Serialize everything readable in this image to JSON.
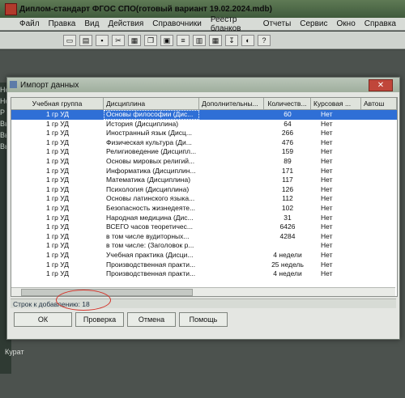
{
  "app": {
    "title": "Диплом-стандарт ФГОС СПО(готовый вариант 19.02.2024.mdb)",
    "menu": [
      "Файл",
      "Правка",
      "Вид",
      "Действия",
      "Справочники",
      "Реестр бланков",
      "Отчеты",
      "Сервис",
      "Окно",
      "Справка"
    ],
    "left_strip": [
      "Нс",
      "Нс",
      "Р",
      "Вы",
      "Вы",
      "Вы"
    ],
    "bottom_text": "Курат"
  },
  "dialog": {
    "title": "Импорт данных",
    "close_label": "✕",
    "columns": [
      "Учебная группа",
      "Дисциплина",
      "Дополнительны...",
      "Количеств...",
      "Курсовая ...",
      "Автош"
    ],
    "rows": [
      {
        "group": "1 гр УД",
        "discipline": "Основы философии (Дис...",
        "extra": "",
        "count": "60",
        "course": "Нет"
      },
      {
        "group": "1 гр УД",
        "discipline": "История (Дисциплина)",
        "extra": "",
        "count": "64",
        "course": "Нет"
      },
      {
        "group": "1 гр УД",
        "discipline": "Иностранный язык (Дисц...",
        "extra": "",
        "count": "266",
        "course": "Нет"
      },
      {
        "group": "1 гр УД",
        "discipline": "Физическая культура (Ди...",
        "extra": "",
        "count": "476",
        "course": "Нет"
      },
      {
        "group": "1 гр УД",
        "discipline": "Религиоведение (Дисципл...",
        "extra": "",
        "count": "159",
        "course": "Нет"
      },
      {
        "group": "1 гр УД",
        "discipline": "Основы мировых религий...",
        "extra": "",
        "count": "89",
        "course": "Нет"
      },
      {
        "group": "1 гр УД",
        "discipline": "Информатика (Дисциплин...",
        "extra": "",
        "count": "171",
        "course": "Нет"
      },
      {
        "group": "1 гр УД",
        "discipline": "Математика (Дисциплина)",
        "extra": "",
        "count": "117",
        "course": "Нет"
      },
      {
        "group": "1 гр УД",
        "discipline": "Психология (Дисциплина)",
        "extra": "",
        "count": "126",
        "course": "Нет"
      },
      {
        "group": "1 гр УД",
        "discipline": "Основы латинского языка...",
        "extra": "",
        "count": "112",
        "course": "Нет"
      },
      {
        "group": "1 гр УД",
        "discipline": "Безопасность жизнедеяте...",
        "extra": "",
        "count": "102",
        "course": "Нет"
      },
      {
        "group": "1 гр УД",
        "discipline": "Народная медицина (Дис...",
        "extra": "",
        "count": "31",
        "course": "Нет"
      },
      {
        "group": "1 гр УД",
        "discipline": "ВСЕГО часов теоретичес...",
        "extra": "",
        "count": "6426",
        "course": "Нет"
      },
      {
        "group": "1 гр УД",
        "discipline": "в том числе вудиторных...",
        "extra": "",
        "count": "4284",
        "course": "Нет"
      },
      {
        "group": "1 гр УД",
        "discipline": "в том числе: (Заголовок р...",
        "extra": "",
        "count": "",
        "course": "Нет"
      },
      {
        "group": "1 гр УД",
        "discipline": "Учебная практика (Дисци...",
        "extra": "",
        "count": "4 недели",
        "course": "Нет"
      },
      {
        "group": "1 гр УД",
        "discipline": "Производственная практи...",
        "extra": "",
        "count": "25 недель",
        "course": "Нет"
      },
      {
        "group": "1 гр УД",
        "discipline": "Производственная практи...",
        "extra": "",
        "count": "4 недели",
        "course": "Нет"
      }
    ],
    "status": "Строк к добавлению: 18",
    "buttons": {
      "ok": "ОК",
      "check": "Проверка",
      "cancel": "Отмена",
      "help": "Помощь"
    }
  }
}
